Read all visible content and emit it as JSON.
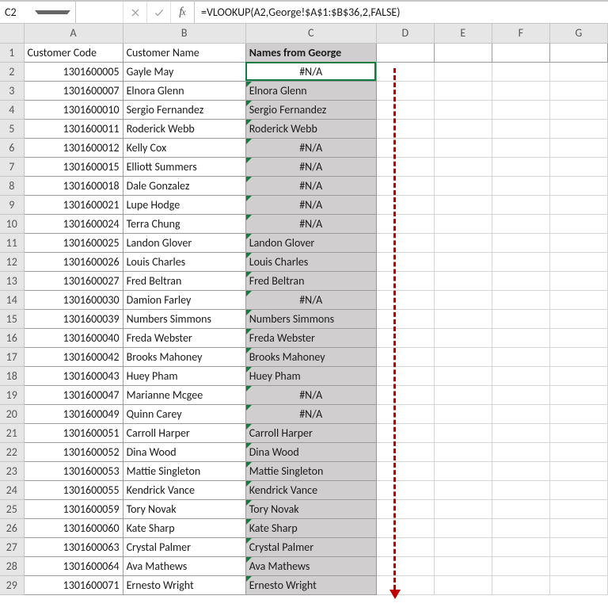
{
  "name_box": "C2",
  "formula": "=VLOOKUP(A2,George!$A$1:$B$36,2,FALSE)",
  "columns": [
    "A",
    "B",
    "C",
    "D",
    "E",
    "F",
    "G"
  ],
  "headers": {
    "A": "Customer Code",
    "B": "Customer Name",
    "C": "Names from George"
  },
  "rows": [
    {
      "n": 2,
      "a": "1301600005",
      "b": "Gayle May",
      "c": "#N/A"
    },
    {
      "n": 3,
      "a": "1301600007",
      "b": "Elnora Glenn",
      "c": "Elnora Glenn"
    },
    {
      "n": 4,
      "a": "1301600010",
      "b": "Sergio Fernandez",
      "c": "Sergio Fernandez"
    },
    {
      "n": 5,
      "a": "1301600011",
      "b": "Roderick Webb",
      "c": "Roderick Webb"
    },
    {
      "n": 6,
      "a": "1301600012",
      "b": "Kelly Cox",
      "c": "#N/A"
    },
    {
      "n": 7,
      "a": "1301600015",
      "b": "Elliott Summers",
      "c": "#N/A"
    },
    {
      "n": 8,
      "a": "1301600018",
      "b": "Dale Gonzalez",
      "c": "#N/A"
    },
    {
      "n": 9,
      "a": "1301600021",
      "b": "Lupe Hodge",
      "c": "#N/A"
    },
    {
      "n": 10,
      "a": "1301600024",
      "b": "Terra Chung",
      "c": "#N/A"
    },
    {
      "n": 11,
      "a": "1301600025",
      "b": "Landon Glover",
      "c": "Landon Glover"
    },
    {
      "n": 12,
      "a": "1301600026",
      "b": "Louis Charles",
      "c": "Louis Charles"
    },
    {
      "n": 13,
      "a": "1301600027",
      "b": "Fred Beltran",
      "c": "Fred Beltran"
    },
    {
      "n": 14,
      "a": "1301600030",
      "b": "Damion Farley",
      "c": "#N/A"
    },
    {
      "n": 15,
      "a": "1301600039",
      "b": "Numbers Simmons",
      "c": "Numbers Simmons"
    },
    {
      "n": 16,
      "a": "1301600040",
      "b": "Freda Webster",
      "c": "Freda Webster"
    },
    {
      "n": 17,
      "a": "1301600042",
      "b": "Brooks Mahoney",
      "c": "Brooks Mahoney"
    },
    {
      "n": 18,
      "a": "1301600043",
      "b": "Huey Pham",
      "c": "Huey Pham"
    },
    {
      "n": 19,
      "a": "1301600047",
      "b": "Marianne Mcgee",
      "c": "#N/A"
    },
    {
      "n": 20,
      "a": "1301600049",
      "b": "Quinn Carey",
      "c": "#N/A"
    },
    {
      "n": 21,
      "a": "1301600051",
      "b": "Carroll Harper",
      "c": "Carroll Harper"
    },
    {
      "n": 22,
      "a": "1301600052",
      "b": "Dina Wood",
      "c": "Dina Wood"
    },
    {
      "n": 23,
      "a": "1301600053",
      "b": "Mattie Singleton",
      "c": "Mattie Singleton"
    },
    {
      "n": 24,
      "a": "1301600055",
      "b": "Kendrick Vance",
      "c": "Kendrick Vance"
    },
    {
      "n": 25,
      "a": "1301600059",
      "b": "Tory Novak",
      "c": "Tory Novak"
    },
    {
      "n": 26,
      "a": "1301600060",
      "b": "Kate Sharp",
      "c": "Kate Sharp"
    },
    {
      "n": 27,
      "a": "1301600063",
      "b": "Crystal Palmer",
      "c": "Crystal Palmer"
    },
    {
      "n": 28,
      "a": "1301600064",
      "b": "Ava Mathews",
      "c": "Ava Mathews"
    },
    {
      "n": 29,
      "a": "1301600071",
      "b": "Ernesto Wright",
      "c": "Ernesto Wright"
    }
  ]
}
